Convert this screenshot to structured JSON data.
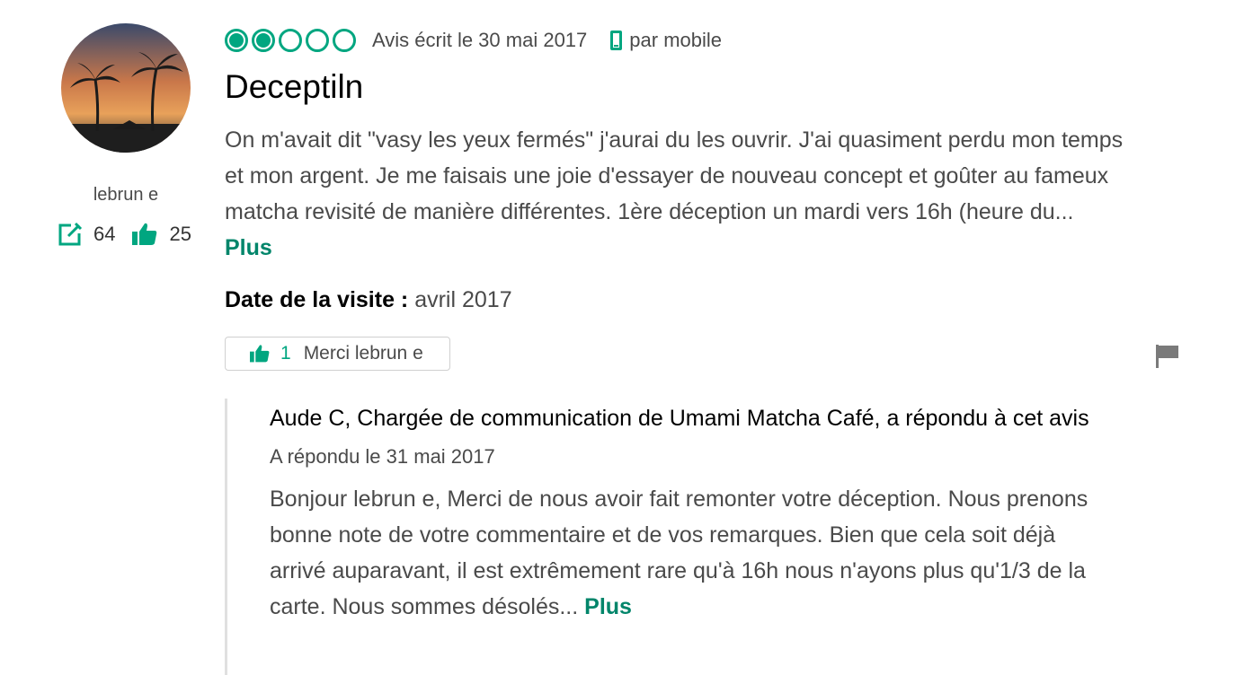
{
  "reviewer": {
    "name": "lebrun e",
    "contributions": "64",
    "helpful_votes": "25",
    "avatar_icon": "avatar-palm-sunset"
  },
  "review": {
    "rating": 2,
    "rating_max": 5,
    "date_text": "Avis écrit le 30 mai 2017",
    "via": "par mobile",
    "title": "Deceptiln",
    "excerpt": "On m'avait dit \"vasy les yeux fermés\" j'aurai du les ouvrir. J'ai quasiment perdu mon temps et mon argent. Je me faisais une joie d'essayer de nouveau concept et goûter au fameux matcha revisité de manière différentes. 1ère déception un mardi vers 16h (heure du...",
    "more_label": "Plus",
    "visit_label": "Date de la visite :",
    "visit_value": "avril 2017"
  },
  "thanks": {
    "count": "1",
    "label": "Merci lebrun e"
  },
  "response": {
    "header": "Aude C, Chargée de communication de Umami Matcha Café, a répondu à cet avis",
    "date_text": "A répondu le 31 mai 2017",
    "excerpt": "Bonjour lebrun e, Merci de nous avoir fait remonter votre déception. Nous prenons bonne note de votre commentaire et de vos remarques. Bien que cela soit déjà arrivé auparavant, il est extrêmement rare qu'à 16h nous n'ayons plus qu'1/3 de la carte. Nous sommes désolés...",
    "more_label": "Plus"
  },
  "colors": {
    "accent": "#00a680",
    "link": "#00856a",
    "text": "#4a4a4a",
    "flag": "#7a7a7a"
  }
}
